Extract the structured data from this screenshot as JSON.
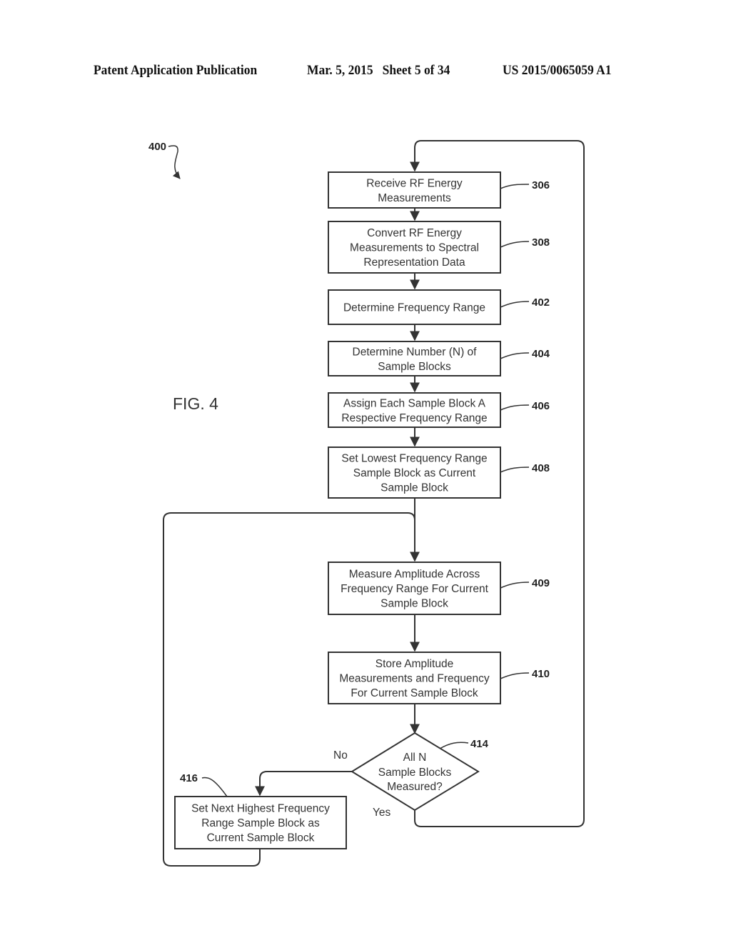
{
  "header": {
    "left": "Patent Application Publication",
    "middle": "Mar. 5, 2015   Sheet 5 of 34",
    "right": "US 2015/0065059 A1"
  },
  "figure": {
    "label": "FIG. 4",
    "ref": "400"
  },
  "steps": [
    {
      "ref": "306",
      "lines": [
        "Receive RF Energy",
        "Measurements"
      ]
    },
    {
      "ref": "308",
      "lines": [
        "Convert RF Energy",
        "Measurements to Spectral",
        "Representation Data"
      ]
    },
    {
      "ref": "402",
      "lines": [
        "Determine Frequency Range"
      ]
    },
    {
      "ref": "404",
      "lines": [
        "Determine Number (N) of",
        "Sample Blocks"
      ]
    },
    {
      "ref": "406",
      "lines": [
        "Assign Each Sample Block A",
        "Respective Frequency Range"
      ]
    },
    {
      "ref": "408",
      "lines": [
        "Set Lowest Frequency Range",
        "Sample Block as Current",
        "Sample Block"
      ]
    },
    {
      "ref": "409",
      "lines": [
        "Measure Amplitude Across",
        "Frequency Range For Current",
        "Sample Block"
      ]
    },
    {
      "ref": "410",
      "lines": [
        "Store Amplitude",
        "Measurements and Frequency",
        "For Current Sample Block"
      ]
    },
    {
      "ref": "416",
      "lines": [
        "Set Next Highest Frequency",
        "Range Sample Block as",
        "Current Sample Block"
      ]
    }
  ],
  "decision": {
    "ref": "414",
    "lines": [
      "All N",
      "Sample Blocks",
      "Measured?"
    ],
    "no_label": "No",
    "yes_label": "Yes"
  }
}
